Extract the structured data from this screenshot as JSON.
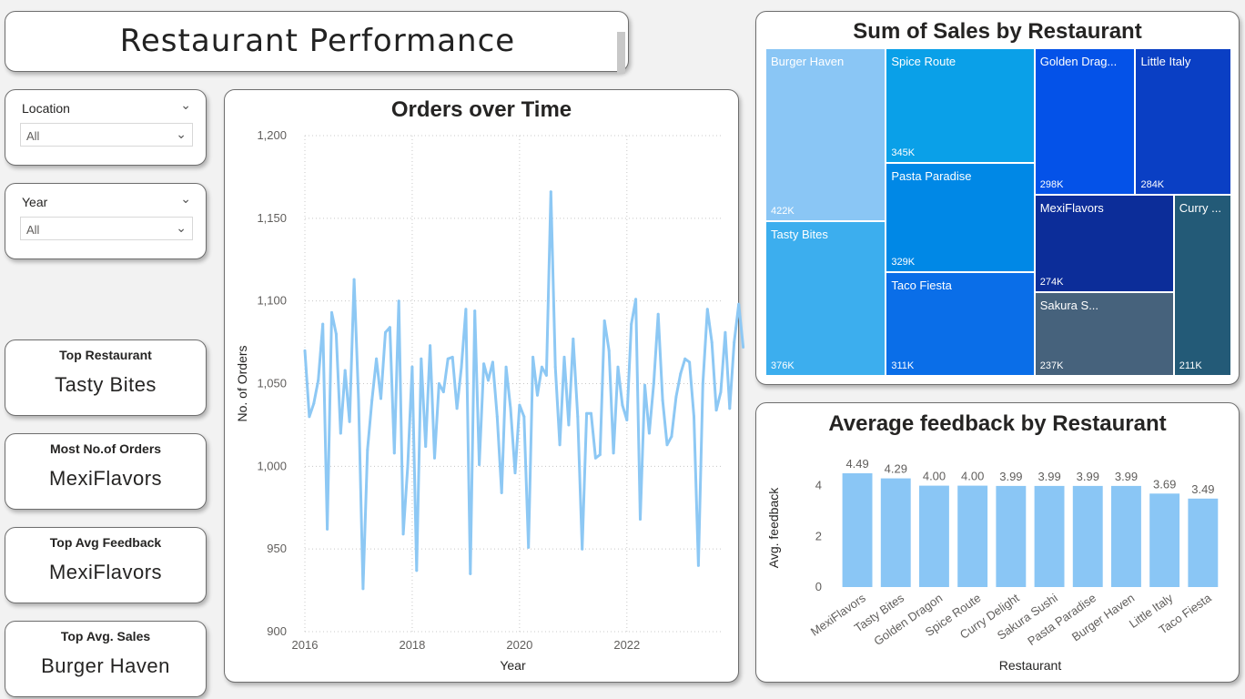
{
  "header": {
    "title": "Restaurant Performance"
  },
  "filters": [
    {
      "label": "Location",
      "value": "All"
    },
    {
      "label": "Year",
      "value": "All"
    }
  ],
  "kpis": [
    {
      "label": "Top Restaurant",
      "value": "Tasty Bites"
    },
    {
      "label": "Most No.of Orders",
      "value": "MexiFlavors"
    },
    {
      "label": "Top Avg Feedback",
      "value": "MexiFlavors"
    },
    {
      "label": "Top Avg. Sales",
      "value": "Burger Haven"
    }
  ],
  "chart_data": [
    {
      "type": "line",
      "title": "Orders over Time",
      "xlabel": "Year",
      "ylabel": "No. of Orders",
      "xticks": [
        "2016",
        "2018",
        "2020",
        "2022"
      ],
      "yticks": [
        "900",
        "950",
        "1,000",
        "1,050",
        "1,100",
        "1,150",
        "1,200"
      ],
      "xlim": [
        2016,
        2023.75
      ],
      "ylim": [
        900,
        1200
      ],
      "grid": true,
      "color": "#8dc8f4",
      "x_start": "2016-01",
      "x_step": "monthly",
      "values": [
        1070,
        1030,
        1038,
        1052,
        1086,
        962,
        1093,
        1080,
        1020,
        1058,
        1027,
        1113,
        1040,
        926,
        1010,
        1040,
        1065,
        1041,
        1081,
        1084,
        1008,
        1100,
        959,
        1000,
        1060,
        937,
        1065,
        1012,
        1073,
        1005,
        1050,
        1045,
        1065,
        1066,
        1035,
        1060,
        1095,
        935,
        1094,
        1001,
        1062,
        1052,
        1063,
        1030,
        984,
        1060,
        1035,
        996,
        1037,
        1030,
        951,
        1066,
        1043,
        1060,
        1055,
        1166,
        1060,
        1013,
        1066,
        1025,
        1077,
        1030,
        950,
        1032,
        1032,
        1005,
        1007,
        1088,
        1070,
        1008,
        1060,
        1037,
        1028,
        1086,
        1101,
        968,
        1049,
        1020,
        1050,
        1092,
        1040,
        1013,
        1018,
        1042,
        1056,
        1065,
        1063,
        1030,
        940,
        1050,
        1095,
        1075,
        1034,
        1045,
        1081,
        1035,
        1075,
        1098,
        1072
      ]
    },
    {
      "type": "treemap",
      "title": "Sum of Sales by Restaurant",
      "items": [
        {
          "name": "Burger Haven",
          "label": "Burger Haven",
          "value_label": "422K",
          "value": 422,
          "color": "#8ac6f5"
        },
        {
          "name": "Tasty Bites",
          "label": "Tasty Bites",
          "value_label": "376K",
          "value": 376,
          "color": "#3caeee"
        },
        {
          "name": "Spice Route",
          "label": "Spice Route",
          "value_label": "345K",
          "value": 345,
          "color": "#0aa0e8"
        },
        {
          "name": "Pasta Paradise",
          "label": "Pasta Paradise",
          "value_label": "329K",
          "value": 329,
          "color": "#0088e6"
        },
        {
          "name": "Taco Fiesta",
          "label": "Taco Fiesta",
          "value_label": "311K",
          "value": 311,
          "color": "#0a6ee8"
        },
        {
          "name": "Golden Dragon",
          "label": "Golden Drag...",
          "value_label": "298K",
          "value": 298,
          "color": "#0452e8"
        },
        {
          "name": "Little Italy",
          "label": "Little Italy",
          "value_label": "284K",
          "value": 284,
          "color": "#0a3fc4"
        },
        {
          "name": "MexiFlavors",
          "label": "MexiFlavors",
          "value_label": "274K",
          "value": 274,
          "color": "#0c2d99"
        },
        {
          "name": "Sakura Sushi",
          "label": "Sakura S...",
          "value_label": "237K",
          "value": 237,
          "color": "#46627c"
        },
        {
          "name": "Curry Delight",
          "label": "Curry ...",
          "value_label": "211K",
          "value": 211,
          "color": "#235a77"
        }
      ]
    },
    {
      "type": "bar",
      "title": "Average feedback by Restaurant",
      "xlabel": "Restaurant",
      "ylabel": "Avg. feedback",
      "categories": [
        "MexiFlavors",
        "Tasty Bites",
        "Golden Dragon",
        "Spice Route",
        "Curry Delight",
        "Sakura Sushi",
        "Pasta Paradise",
        "Burger Haven",
        "Little Italy",
        "Taco Fiesta"
      ],
      "values": [
        4.49,
        4.29,
        4.0,
        4.0,
        3.99,
        3.99,
        3.99,
        3.99,
        3.69,
        3.49
      ],
      "value_labels": [
        "4.49",
        "4.29",
        "4.00",
        "4.00",
        "3.99",
        "3.99",
        "3.99",
        "3.99",
        "3.69",
        "3.49"
      ],
      "yticks": [
        "0",
        "2",
        "4"
      ],
      "ylim": [
        0,
        5.1
      ],
      "color": "#8ac6f5"
    }
  ]
}
